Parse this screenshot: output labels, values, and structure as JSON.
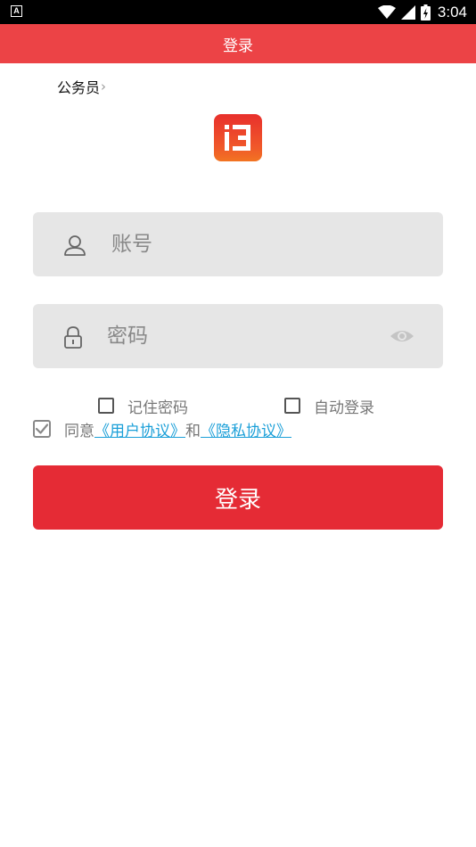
{
  "status_bar": {
    "time": "3:04",
    "app_icon_letter": "A",
    "icons": [
      "wifi-icon",
      "signal-icon",
      "battery-icon"
    ]
  },
  "header": {
    "title": "登录",
    "color": "#ec4346"
  },
  "role_selector": {
    "label": "公务员",
    "chevron": "›"
  },
  "logo": {
    "icon": "app-logo-icon",
    "colors": [
      "#e8302c",
      "#f27422"
    ]
  },
  "form": {
    "account_placeholder": "账号",
    "password_placeholder": "密码",
    "remember_label": "记住密码",
    "remember_checked": false,
    "auto_login_label": "自动登录",
    "auto_login_checked": false
  },
  "agreement": {
    "checked": true,
    "prefix": "同意",
    "user_agreement": "《用户协议》",
    "and": "和",
    "privacy_policy": "《隐私协议》"
  },
  "login_button": {
    "label": "登录",
    "color": "#e52b35"
  }
}
